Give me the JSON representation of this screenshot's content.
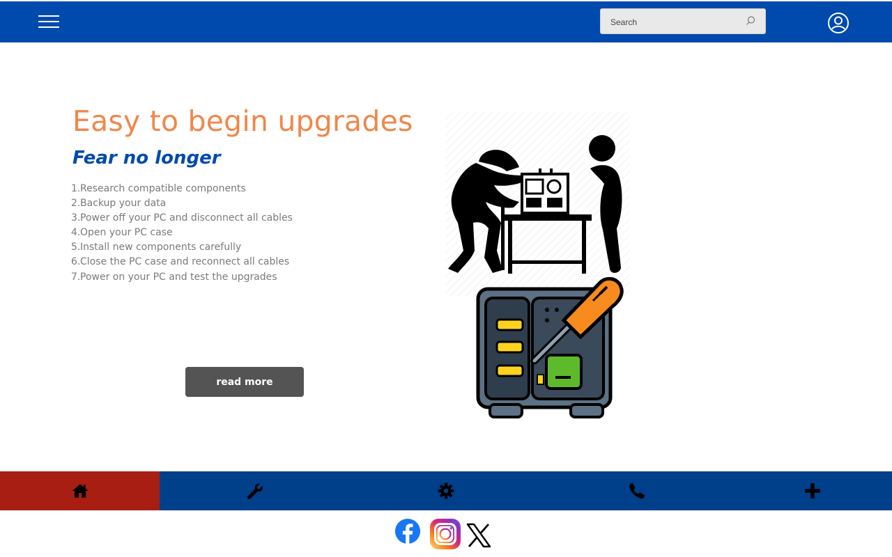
{
  "header": {
    "search": {
      "placeholder": "Search"
    }
  },
  "hero": {
    "title": "Easy to begin upgrades",
    "subtitle": "Fear no longer",
    "steps": [
      {
        "n": "1.",
        "text": "Research compatible components"
      },
      {
        "n": "2.",
        "text": "Backup your data"
      },
      {
        "n": "3.",
        "text": "Power off your PC and disconnect all cables"
      },
      {
        "n": "4.",
        "text": "Open your PC case"
      },
      {
        "n": "5.",
        "text": "Install new components carefully"
      },
      {
        "n": "6.",
        "text": "Close the PC case and reconnect all cables"
      },
      {
        "n": "7.",
        "text": "Power on your PC and test the upgrades"
      }
    ],
    "button_label": "read more"
  },
  "bottom_nav": {
    "items": [
      {
        "icon": "home-icon",
        "active": true
      },
      {
        "icon": "wrench-icon",
        "active": false
      },
      {
        "icon": "gear-icon",
        "active": false
      },
      {
        "icon": "phone-icon",
        "active": false
      },
      {
        "icon": "plus-icon",
        "active": false
      }
    ],
    "active_color": "#a81e12",
    "bar_color": "#003f8a"
  },
  "social": [
    "facebook-icon",
    "instagram-icon",
    "x-icon"
  ],
  "colors": {
    "header": "#004aad",
    "title": "#f0874a",
    "subtitle": "#004aad",
    "button": "#545454"
  }
}
